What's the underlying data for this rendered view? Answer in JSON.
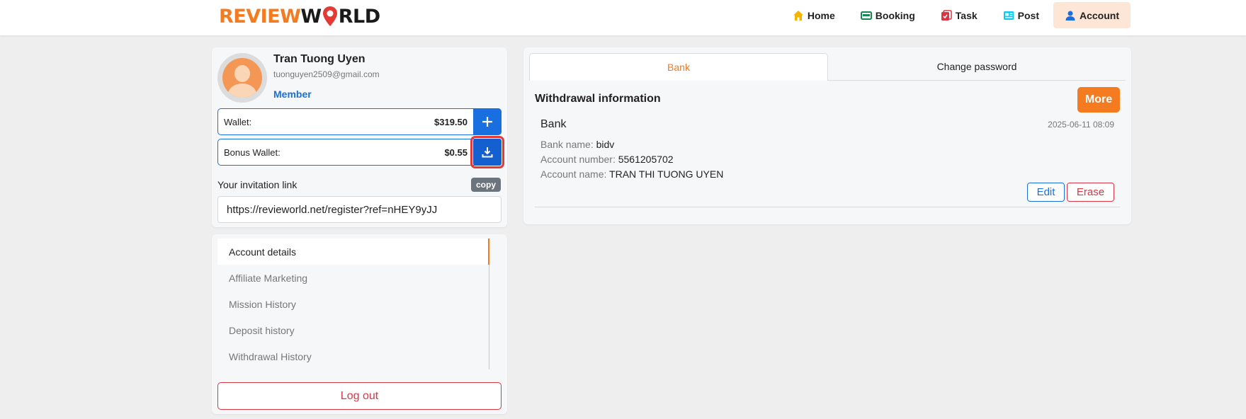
{
  "header": {
    "logo_part1": "REVIEW",
    "logo_part2": "RLD",
    "nav": [
      {
        "label": "Home",
        "icon": "home-icon",
        "color": "#f5b400"
      },
      {
        "label": "Booking",
        "icon": "booking-icon",
        "color": "#198754"
      },
      {
        "label": "Task",
        "icon": "task-icon",
        "color": "#dc3545"
      },
      {
        "label": "Post",
        "icon": "post-icon",
        "color": "#0dcaf0"
      },
      {
        "label": "Account",
        "icon": "account-icon",
        "color": "#1a6fe0"
      }
    ]
  },
  "profile": {
    "name": "Tran Tuong Uyen",
    "email": "tuonguyen2509@gmail.com",
    "role": "Member",
    "wallet_label": "Wallet:",
    "wallet_value": "$319.50",
    "bonus_label": "Bonus Wallet:",
    "bonus_value": "$0.55",
    "invite_label": "Your invitation link",
    "copy_label": "copy",
    "invite_link": "https://revieworld.net/register?ref=nHEY9yJJ"
  },
  "menu": {
    "items": [
      {
        "label": "Account details"
      },
      {
        "label": "Affiliate Marketing"
      },
      {
        "label": "Mission History"
      },
      {
        "label": "Deposit history"
      },
      {
        "label": "Withdrawal History"
      }
    ],
    "logout": "Log out"
  },
  "right": {
    "tabs": [
      {
        "label": "Bank"
      },
      {
        "label": "Change password"
      }
    ],
    "section_title": "Withdrawal information",
    "more_label": "More",
    "bank": {
      "title": "Bank",
      "date": "2025-06-11 08:09",
      "bank_name_label": "Bank name:",
      "bank_name": "bidv",
      "account_number_label": "Account number:",
      "account_number": "5561205702",
      "account_name_label": "Account name:",
      "account_name": "TRAN THI TUONG UYEN"
    },
    "edit_label": "Edit",
    "erase_label": "Erase"
  },
  "colors": {
    "brand_orange": "#f47b1f",
    "primary_blue": "#1a6fe0",
    "danger_red": "#dc3545"
  }
}
